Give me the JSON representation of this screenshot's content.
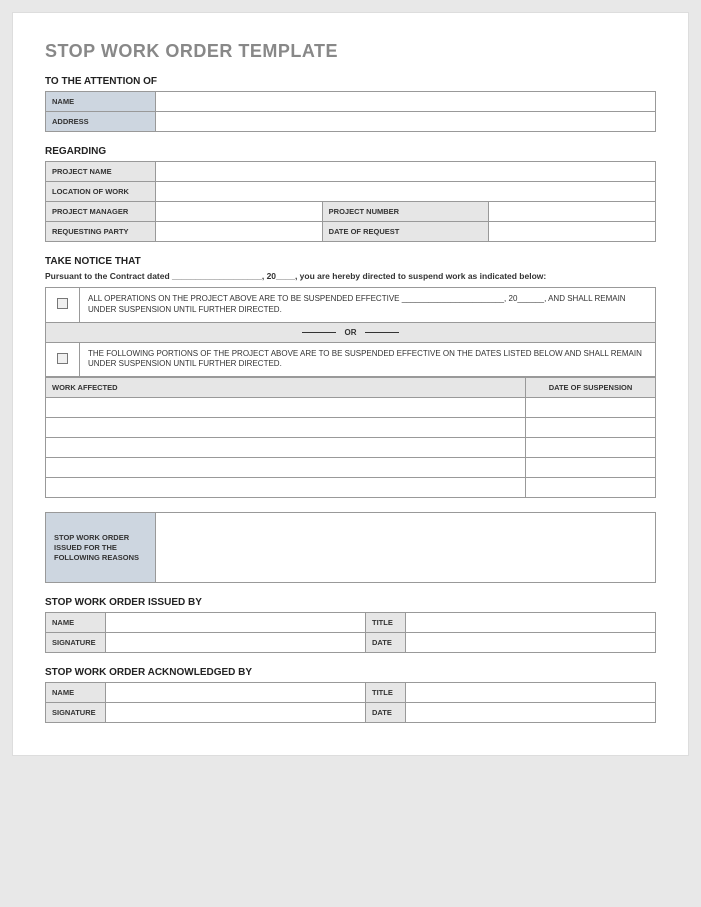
{
  "title": "STOP WORK ORDER TEMPLATE",
  "attention": {
    "heading": "TO THE ATTENTION OF",
    "name_label": "NAME",
    "address_label": "ADDRESS"
  },
  "regarding": {
    "heading": "REGARDING",
    "project_name_label": "PROJECT NAME",
    "location_label": "LOCATION OF WORK",
    "pm_label": "PROJECT MANAGER",
    "project_number_label": "PROJECT NUMBER",
    "requesting_party_label": "REQUESTING PARTY",
    "date_request_label": "DATE OF REQUEST"
  },
  "notice": {
    "heading": "TAKE NOTICE THAT",
    "pursuant": "Pursuant to the Contract dated ___________________, 20____, you are hereby directed to suspend work as indicated below:",
    "option_a": "ALL OPERATIONS ON THE PROJECT ABOVE ARE TO BE SUSPENDED EFFECTIVE _______________________, 20______, AND SHALL REMAIN UNDER SUSPENSION UNTIL FURTHER DIRECTED.",
    "or_label": "OR",
    "option_b": "THE FOLLOWING PORTIONS OF THE PROJECT ABOVE ARE TO BE SUSPENDED EFFECTIVE ON THE DATES LISTED BELOW AND SHALL REMAIN UNDER SUSPENSION UNTIL FURTHER DIRECTED.",
    "work_affected_label": "WORK AFFECTED",
    "date_suspension_label": "DATE OF SUSPENSION"
  },
  "reasons": {
    "label": "STOP WORK ORDER ISSUED FOR THE FOLLOWING REASONS"
  },
  "issued_by": {
    "heading": "STOP WORK ORDER ISSUED BY",
    "name_label": "NAME",
    "title_label": "TITLE",
    "signature_label": "SIGNATURE",
    "date_label": "DATE"
  },
  "ack_by": {
    "heading": "STOP WORK ORDER ACKNOWLEDGED BY",
    "name_label": "NAME",
    "title_label": "TITLE",
    "signature_label": "SIGNATURE",
    "date_label": "DATE"
  }
}
